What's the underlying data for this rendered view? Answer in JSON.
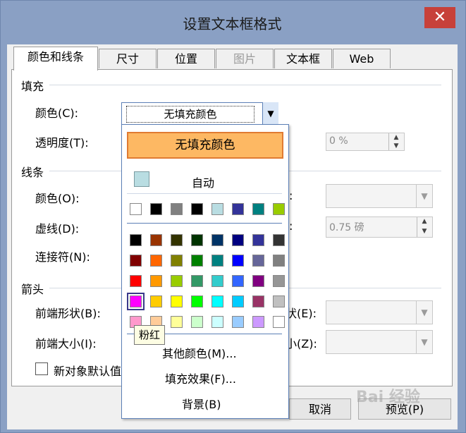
{
  "dialog": {
    "title": "设置文本框格式",
    "close_glyph": "✕",
    "tabs": [
      {
        "label": "颜色和线条",
        "state": "active"
      },
      {
        "label": "尺寸",
        "state": "normal"
      },
      {
        "label": "位置",
        "state": "normal"
      },
      {
        "label": "图片",
        "state": "disabled"
      },
      {
        "label": "文本框",
        "state": "normal"
      },
      {
        "label": "Web",
        "state": "normal"
      }
    ],
    "fill": {
      "group_label": "填充",
      "color_label": "颜色(C):",
      "color_value": "无填充颜色",
      "transparency_label": "透明度(T):",
      "transparency_value": "0 %"
    },
    "line": {
      "group_label": "线条",
      "color_label": "颜色(O):",
      "dash_label": "虚线(D):",
      "connector_label": "连接符(N):",
      "weight_value": "0.75 磅",
      "colon1": ":",
      "colon2": ":"
    },
    "arrows": {
      "group_label": "箭头",
      "begin_style_label": "前端形状(B):",
      "begin_size_label": "前端大小(I):",
      "end_style_suffix": "状(E):",
      "end_size_suffix": "小(Z):"
    },
    "default_checkbox_label": "新对象默认值",
    "buttons": {
      "cancel": "取消",
      "preview": "预览(P)"
    }
  },
  "color_popup": {
    "no_fill_label": "无填充颜色",
    "auto_label": "自动",
    "auto_swatch_color": "#b9dde2",
    "recent_colors": [
      "#ffffff",
      "#000000",
      "#808080",
      "#000000",
      "#b9dde2",
      "#333399",
      "#008080",
      "#99cc00"
    ],
    "palette": [
      [
        "#000000",
        "#993300",
        "#333300",
        "#003300",
        "#003366",
        "#000080",
        "#333399",
        "#333333"
      ],
      [
        "#800000",
        "#ff6600",
        "#808000",
        "#008000",
        "#008080",
        "#0000ff",
        "#666699",
        "#808080"
      ],
      [
        "#ff0000",
        "#ff9900",
        "#99cc00",
        "#339966",
        "#33cccc",
        "#3366ff",
        "#800080",
        "#969696"
      ],
      [
        "#ff00ff",
        "#ffcc00",
        "#ffff00",
        "#00ff00",
        "#00ffff",
        "#00ccff",
        "#993366",
        "#c0c0c0"
      ],
      [
        "#ff99cc",
        "#ffcc99",
        "#ffff99",
        "#ccffcc",
        "#ccffff",
        "#99ccff",
        "#cc99ff",
        "#ffffff"
      ]
    ],
    "selected_swatch": {
      "row": 3,
      "col": 0
    },
    "tooltip": "粉红",
    "more_colors": "其他颜色(M)...",
    "fill_effects": "填充效果(F)...",
    "background": "背景(B)"
  },
  "watermark": "Bai 经验"
}
